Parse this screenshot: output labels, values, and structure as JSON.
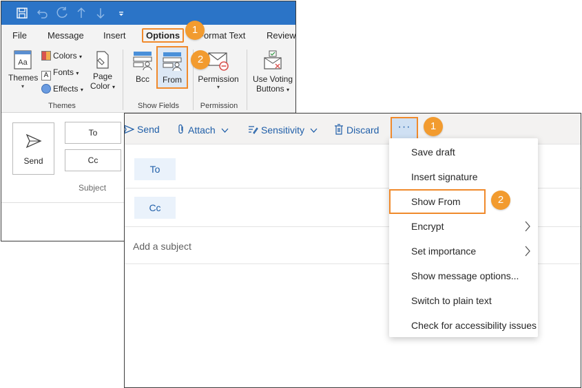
{
  "desktop": {
    "tabs": [
      "File",
      "Message",
      "Insert",
      "Options",
      "Format Text",
      "Review"
    ],
    "active_tab": "Options",
    "ribbon": {
      "themes": "Themes",
      "colors": "Colors",
      "fonts": "Fonts",
      "effects": "Effects",
      "page_color_1": "Page",
      "page_color_2": "Color",
      "bcc": "Bcc",
      "from": "From",
      "permission": "Permission",
      "use_voting_1": "Use Voting",
      "use_voting_2": "Buttons"
    },
    "groups": {
      "themes": "Themes",
      "show_fields": "Show Fields",
      "permission": "Permission"
    },
    "compose": {
      "send": "Send",
      "to": "To",
      "cc": "Cc",
      "subject": "Subject"
    }
  },
  "web": {
    "toolbar": {
      "send": "Send",
      "attach": "Attach",
      "sensitivity": "Sensitivity",
      "discard": "Discard",
      "more": "···"
    },
    "fields": {
      "to": "To",
      "cc": "Cc",
      "subject_placeholder": "Add a subject"
    },
    "menu": [
      {
        "label": "Save draft"
      },
      {
        "label": "Insert signature"
      },
      {
        "label": "Show From"
      },
      {
        "label": "Encrypt"
      },
      {
        "label": "Set importance"
      },
      {
        "label": "Show message options..."
      },
      {
        "label": "Switch to plain text"
      },
      {
        "label": "Check for accessibility issues"
      }
    ]
  },
  "callouts": {
    "one": "1",
    "two": "2"
  },
  "colors": {
    "accent_orange": "#f0892a",
    "outlook_blue": "#2b74c7",
    "link_blue": "#1f5ea8"
  }
}
